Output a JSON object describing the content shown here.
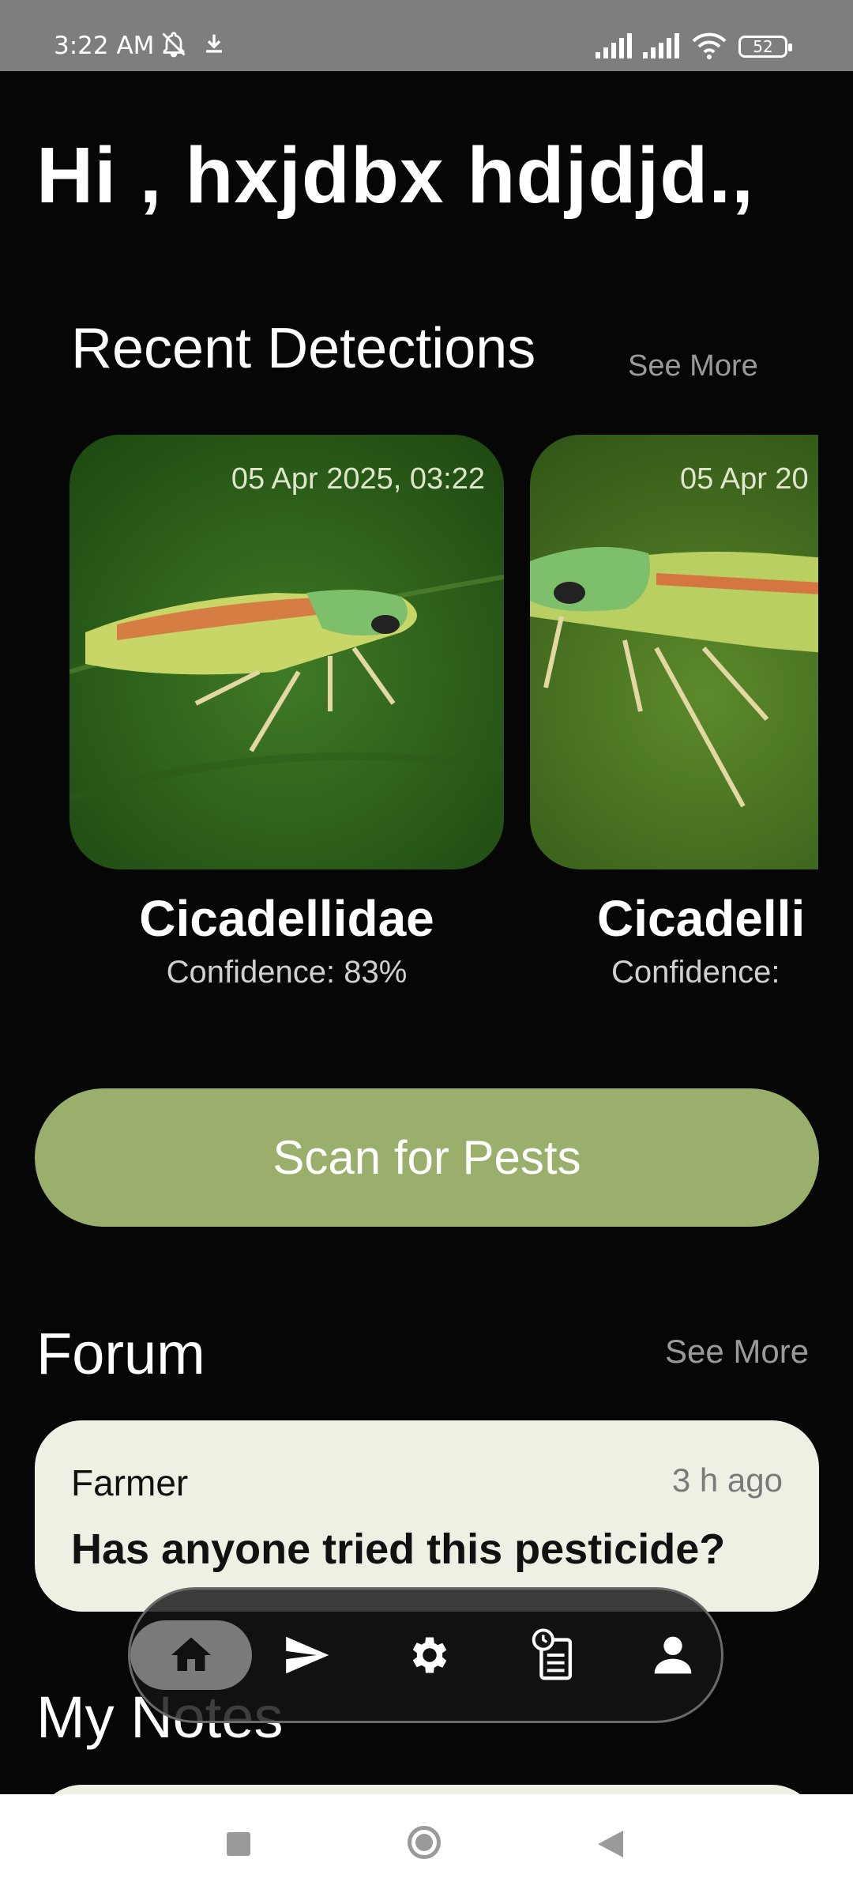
{
  "status_bar": {
    "time": "3:22 AM",
    "battery": "52",
    "icons": [
      "bell-off-icon",
      "download-icon",
      "signal-icon",
      "signal-icon",
      "wifi-icon",
      "battery-icon"
    ]
  },
  "greeting": "Hi , hxjdbx hdjdjd.,",
  "recent": {
    "title": "Recent Detections",
    "see_more": "See More",
    "items": [
      {
        "date": "05 Apr 2025, 03:22",
        "name": "Cicadellidae",
        "confidence": "Confidence: 83%"
      },
      {
        "date": "05 Apr 20",
        "name": "Cicadelli",
        "confidence": "Confidence: "
      }
    ]
  },
  "scan_button": "Scan for Pests",
  "forum": {
    "title": "Forum",
    "see_more": "See More",
    "post": {
      "author": "Farmer",
      "time": "3 h ago",
      "text": "Has anyone tried this pesticide?"
    }
  },
  "notes": {
    "title": "My Notes"
  },
  "bottom_nav": {
    "items": [
      "home-icon",
      "send-icon",
      "settings-icon",
      "history-icon",
      "profile-icon"
    ],
    "active": "home-icon"
  },
  "colors": {
    "accent": "#9aaf6b",
    "card": "#eff0e4",
    "background": "#060606"
  }
}
